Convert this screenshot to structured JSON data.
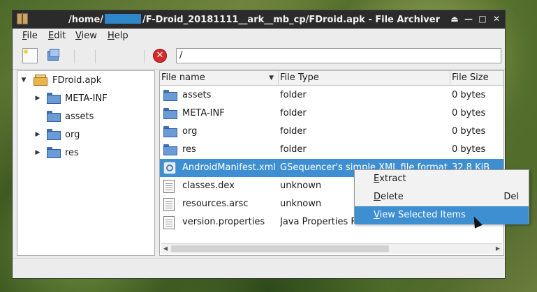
{
  "window": {
    "title_prefix": "/home/",
    "title_suffix": "/F-Droid_20181111__ark__mb_cp/FDroid.apk - File Archiver",
    "controls": [
      "⏏",
      "—",
      "□",
      "✕"
    ]
  },
  "menubar": {
    "items": [
      {
        "label": "File",
        "accel": "F"
      },
      {
        "label": "Edit",
        "accel": "E"
      },
      {
        "label": "View",
        "accel": "V"
      },
      {
        "label": "Help",
        "accel": "H"
      }
    ]
  },
  "toolbar": {
    "stop_glyph": "✕",
    "location": "/"
  },
  "tree": {
    "root": "FDroid.apk",
    "items": [
      {
        "label": "META-INF",
        "expandable": true
      },
      {
        "label": "assets",
        "expandable": false
      },
      {
        "label": "org",
        "expandable": true
      },
      {
        "label": "res",
        "expandable": true
      }
    ]
  },
  "list": {
    "columns": [
      "File name",
      "File Type",
      "File Size"
    ],
    "rows": [
      {
        "name": "assets",
        "type": "folder",
        "size": "0 bytes",
        "kind": "folder"
      },
      {
        "name": "META-INF",
        "type": "folder",
        "size": "0 bytes",
        "kind": "folder"
      },
      {
        "name": "org",
        "type": "folder",
        "size": "0 bytes",
        "kind": "folder"
      },
      {
        "name": "res",
        "type": "folder",
        "size": "0 bytes",
        "kind": "folder"
      },
      {
        "name": "AndroidManifest.xml",
        "type": "GSequencer's simple XML file format",
        "size": "32.8  KiB",
        "kind": "xml",
        "selected": true
      },
      {
        "name": "classes.dex",
        "type": "unknown",
        "size": "",
        "kind": "file"
      },
      {
        "name": "resources.arsc",
        "type": "unknown",
        "size": "",
        "kind": "file"
      },
      {
        "name": "version.properties",
        "type": "Java Properties F",
        "size": "",
        "kind": "file"
      }
    ]
  },
  "context_menu": {
    "items": [
      {
        "label": "Extract",
        "accel": "E",
        "shortcut": ""
      },
      {
        "label": "Delete",
        "accel": "D",
        "shortcut": "Del"
      },
      {
        "label": "View Selected Items",
        "accel": "V",
        "shortcut": "",
        "highlighted": true
      }
    ]
  },
  "colors": {
    "selection": "#3d8fd1",
    "titlebar": "#2b2b2b",
    "folder": "#6b9bd6"
  }
}
